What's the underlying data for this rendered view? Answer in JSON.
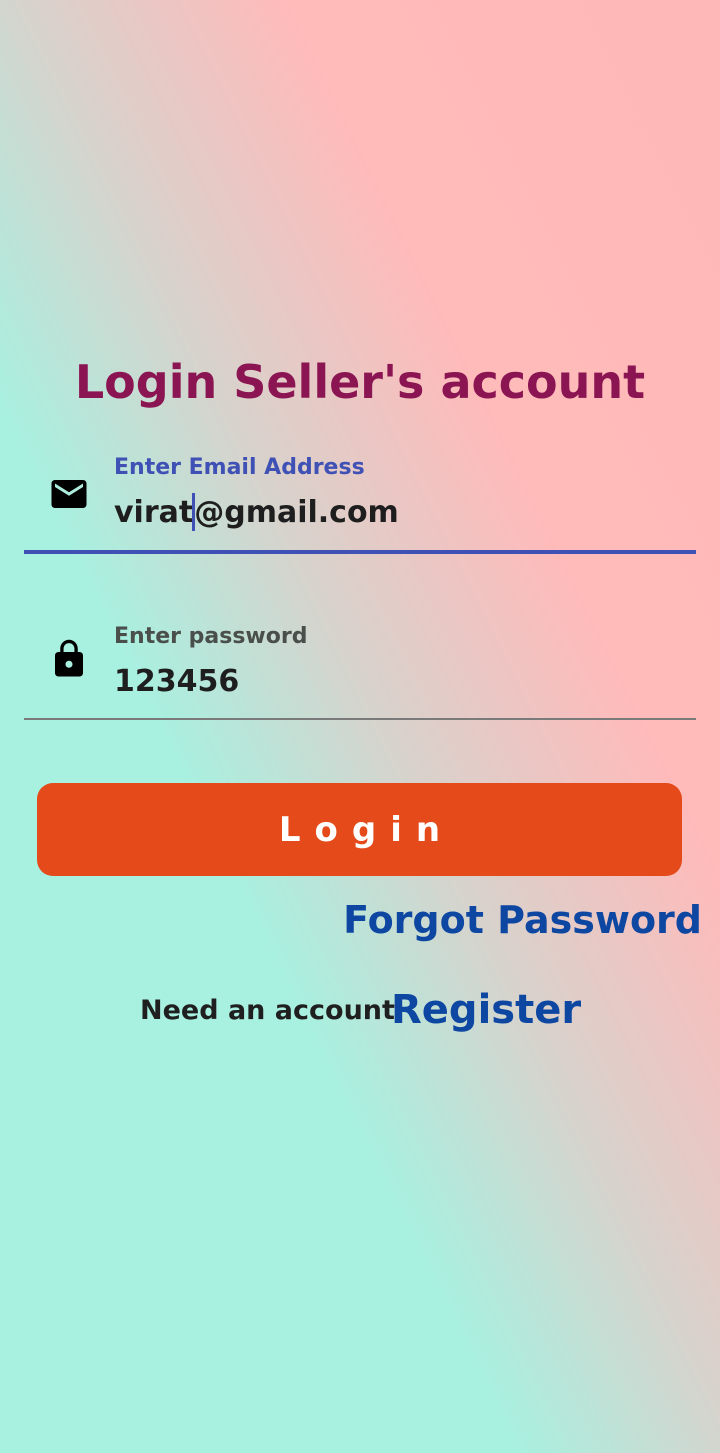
{
  "title": "Login Seller's account",
  "email": {
    "icon": "mail-icon",
    "label": "Enter Email Address",
    "value_before_caret": "virat",
    "value_after_caret": "@gmail.com"
  },
  "password": {
    "icon": "lock-icon",
    "label": "Enter password",
    "value": "123456"
  },
  "login_button": "Login",
  "forgot_password": "Forgot Password",
  "register_prompt": "Need an account",
  "register_link": "Register",
  "colors": {
    "title": "#8b1452",
    "accent": "#3f51b5",
    "login_button": "#e44a1a",
    "link": "#0d47a1"
  }
}
